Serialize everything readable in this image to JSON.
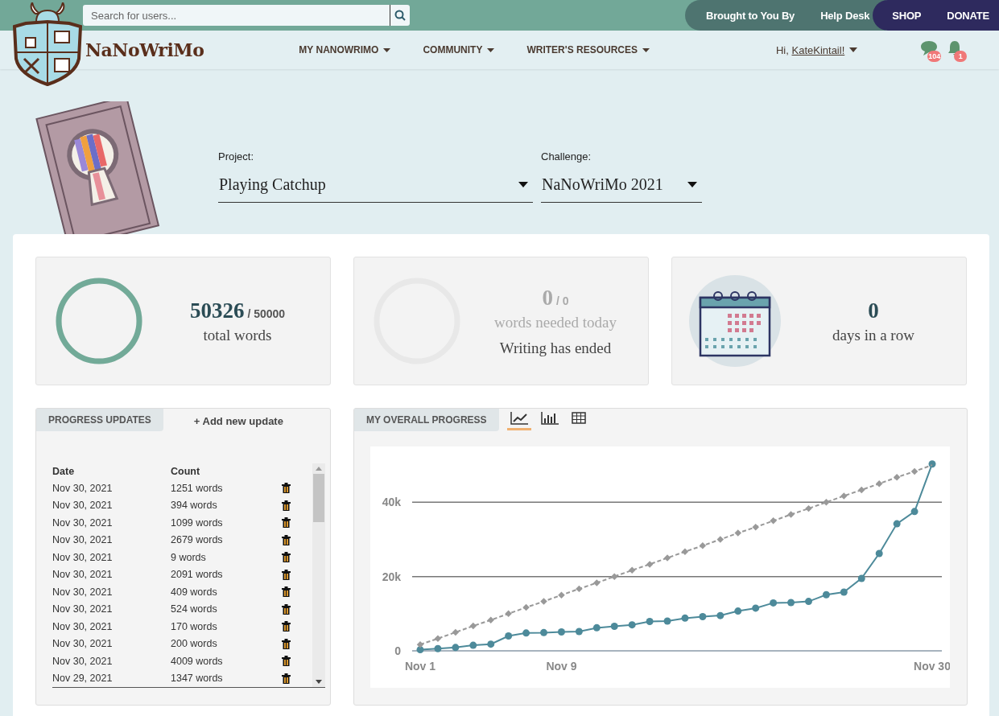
{
  "top_bar": {
    "search": {
      "placeholder": "Search for users..."
    },
    "links": [
      "Brought to You By",
      "Help Desk"
    ],
    "shop_links": [
      "SHOP",
      "DONATE"
    ]
  },
  "nav": {
    "logo": "NaNoWriMo",
    "menus": [
      "MY NANOWRIMO",
      "COMMUNITY",
      "WRITER'S RESOURCES"
    ],
    "greeting": "Hi, ",
    "user": "KateKintail!",
    "message_count": "104",
    "notification_count": "1"
  },
  "project": {
    "label": "Project:",
    "value": "Playing Catchup"
  },
  "challenge": {
    "label": "Challenge:",
    "value": "NaNoWriMo 2021"
  },
  "stats": {
    "total": {
      "value": "50326",
      "goal": "/ 50000",
      "label": "total words",
      "level": 1
    },
    "today": {
      "value": "0",
      "goal": "/ 0",
      "label": "words needed today",
      "note": "Writing has ended",
      "level": 0
    },
    "streak": {
      "value": "0",
      "label": "days in a row"
    }
  },
  "progress_updates": {
    "tab": "PROGRESS UPDATES",
    "add": "+ Add new update",
    "columns": [
      "Date",
      "Count"
    ],
    "rows": [
      {
        "date": "Nov 30, 2021",
        "count": "1251 words"
      },
      {
        "date": "Nov 30, 2021",
        "count": "394 words"
      },
      {
        "date": "Nov 30, 2021",
        "count": "1099 words"
      },
      {
        "date": "Nov 30, 2021",
        "count": "2679 words"
      },
      {
        "date": "Nov 30, 2021",
        "count": "9 words"
      },
      {
        "date": "Nov 30, 2021",
        "count": "2091 words"
      },
      {
        "date": "Nov 30, 2021",
        "count": "409 words"
      },
      {
        "date": "Nov 30, 2021",
        "count": "524 words"
      },
      {
        "date": "Nov 30, 2021",
        "count": "170 words"
      },
      {
        "date": "Nov 30, 2021",
        "count": "200 words"
      },
      {
        "date": "Nov 30, 2021",
        "count": "4009 words"
      },
      {
        "date": "Nov 29, 2021",
        "count": "1347 words"
      }
    ]
  },
  "overall_progress": {
    "tab": "MY OVERALL PROGRESS",
    "views": [
      {
        "kind": "line",
        "selected": true
      },
      {
        "kind": "bar",
        "selected": false
      },
      {
        "kind": "table",
        "selected": false
      }
    ],
    "chart_data": {
      "type": "line",
      "categories": [
        "Nov 1",
        null,
        null,
        null,
        null,
        null,
        null,
        null,
        "Nov 9",
        null,
        null,
        null,
        null,
        null,
        null,
        null,
        null,
        null,
        null,
        null,
        null,
        null,
        null,
        null,
        null,
        null,
        null,
        null,
        null,
        "Nov 30"
      ],
      "ylim": [
        0,
        55000
      ],
      "yticks": [
        0,
        {
          "value": 20000,
          "label": "20k"
        },
        {
          "value": 40000,
          "label": "40k"
        }
      ],
      "series": [
        {
          "color": "#4d8a9a",
          "line_style": "solid",
          "marker": "circle",
          "values": [
            300,
            600,
            900,
            1500,
            1800,
            4000,
            4800,
            4900,
            5100,
            5200,
            6200,
            6600,
            7000,
            7900,
            8000,
            8800,
            9200,
            9500,
            10700,
            11500,
            12900,
            13000,
            13300,
            15100,
            15800,
            19500,
            26200,
            34200,
            37500,
            50300
          ]
        },
        {
          "color": "#999999",
          "line_style": "dashed",
          "marker": "diamond",
          "values": [
            1700,
            3300,
            5000,
            6700,
            8300,
            10000,
            11700,
            13300,
            15000,
            16700,
            18300,
            20000,
            21700,
            23300,
            25000,
            26700,
            28300,
            30000,
            31700,
            33300,
            35000,
            36700,
            38300,
            40000,
            41700,
            43300,
            45000,
            46700,
            48300,
            50000
          ]
        }
      ]
    }
  }
}
